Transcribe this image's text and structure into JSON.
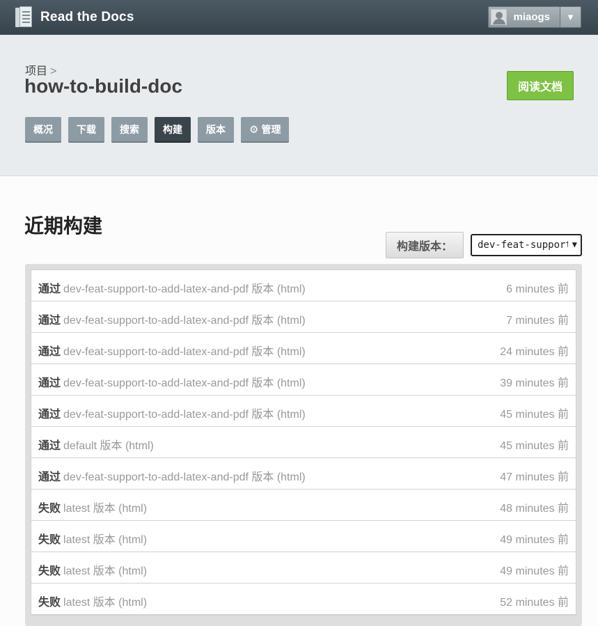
{
  "app": {
    "name": "Read the Docs"
  },
  "user": {
    "name": "miaogs",
    "toggle_glyph": "▼"
  },
  "breadcrumb": {
    "label": "项目",
    "separator": ">"
  },
  "project": {
    "title": "how-to-build-doc"
  },
  "read_docs_button": "阅读文档",
  "tabs": [
    {
      "label": "概况"
    },
    {
      "label": "下载"
    },
    {
      "label": "搜索"
    },
    {
      "label": "构建",
      "active": true
    },
    {
      "label": "版本"
    },
    {
      "label": "管理",
      "icon": "gear-icon"
    }
  ],
  "builds": {
    "title": "近期构建",
    "version_label": "构建版本：",
    "version_selected": "dev-feat-support-to-add-latex-and-pdf",
    "rows": [
      {
        "status": "通过",
        "desc": "dev-feat-support-to-add-latex-and-pdf 版本 (html)",
        "time": "6 minutes 前"
      },
      {
        "status": "通过",
        "desc": "dev-feat-support-to-add-latex-and-pdf 版本 (html)",
        "time": "7 minutes 前"
      },
      {
        "status": "通过",
        "desc": "dev-feat-support-to-add-latex-and-pdf 版本 (html)",
        "time": "24 minutes 前"
      },
      {
        "status": "通过",
        "desc": "dev-feat-support-to-add-latex-and-pdf 版本 (html)",
        "time": "39 minutes 前"
      },
      {
        "status": "通过",
        "desc": "dev-feat-support-to-add-latex-and-pdf 版本 (html)",
        "time": "45 minutes 前"
      },
      {
        "status": "通过",
        "desc": "default 版本 (html)",
        "time": "45 minutes 前"
      },
      {
        "status": "通过",
        "desc": "dev-feat-support-to-add-latex-and-pdf 版本 (html)",
        "time": "47 minutes 前"
      },
      {
        "status": "失败",
        "desc": "latest 版本 (html)",
        "time": "48 minutes 前"
      },
      {
        "status": "失败",
        "desc": "latest 版本 (html)",
        "time": "49 minutes 前"
      },
      {
        "status": "失败",
        "desc": "latest 版本 (html)",
        "time": "49 minutes 前"
      },
      {
        "status": "失败",
        "desc": "latest 版本 (html)",
        "time": "52 minutes 前"
      }
    ]
  },
  "colors": {
    "read_button": "#7dc243",
    "active_tab": "#3a444b",
    "tab": "#8d9ba4",
    "topbar": "#414e56"
  }
}
